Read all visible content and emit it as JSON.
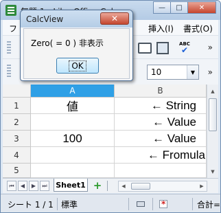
{
  "window": {
    "title": "無題 1 - LibreOffice Calc",
    "minimize_label": "—",
    "maximize_label": "□",
    "close_label": "✕"
  },
  "menu": {
    "file": "フ",
    "insert": "挿入(I)",
    "format": "書式(O)"
  },
  "toolbar": {
    "overflow_label": "»",
    "spell_label": "ABC",
    "spell_check_mark": "✔",
    "font_size": "10",
    "combo_arrow": "▼"
  },
  "grid": {
    "columns": [
      "A",
      "B"
    ],
    "rows": [
      {
        "num": "1",
        "a": "値",
        "b": "← String"
      },
      {
        "num": "2",
        "a": "",
        "b": "← Value"
      },
      {
        "num": "3",
        "a": "100",
        "b": "← Value"
      },
      {
        "num": "4",
        "a": "",
        "b": "← Fromula"
      },
      {
        "num": "5",
        "a": "",
        "b": ""
      }
    ]
  },
  "tabs": {
    "nav_first": "⏮",
    "nav_prev": "◀",
    "nav_next": "▶",
    "nav_last": "⏭",
    "sheet_name": "Sheet1",
    "add_sheet": "+"
  },
  "scroll": {
    "up": "▲",
    "down": "▼",
    "left": "◀",
    "right": "▶"
  },
  "status": {
    "sheet": "シート 1 / 1",
    "style": "標準",
    "sum": "合計="
  },
  "dialog": {
    "title": "CalcView",
    "close_label": "✕",
    "message": "Zero( = 0 ) 非表示",
    "ok_label": "OK"
  },
  "colors": {
    "selected_column_header": "#2fa0e6",
    "title_bar": "#c9dbee",
    "close_button": "#c6452d"
  }
}
